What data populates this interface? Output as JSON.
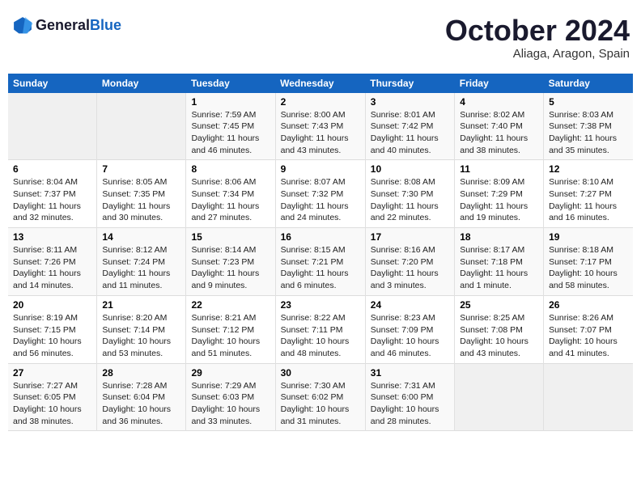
{
  "header": {
    "logo_general": "General",
    "logo_blue": "Blue",
    "month_year": "October 2024",
    "location": "Aliaga, Aragon, Spain"
  },
  "weekdays": [
    "Sunday",
    "Monday",
    "Tuesday",
    "Wednesday",
    "Thursday",
    "Friday",
    "Saturday"
  ],
  "weeks": [
    [
      {
        "day": "",
        "info": ""
      },
      {
        "day": "",
        "info": ""
      },
      {
        "day": "1",
        "info": "Sunrise: 7:59 AM\nSunset: 7:45 PM\nDaylight: 11 hours and 46 minutes."
      },
      {
        "day": "2",
        "info": "Sunrise: 8:00 AM\nSunset: 7:43 PM\nDaylight: 11 hours and 43 minutes."
      },
      {
        "day": "3",
        "info": "Sunrise: 8:01 AM\nSunset: 7:42 PM\nDaylight: 11 hours and 40 minutes."
      },
      {
        "day": "4",
        "info": "Sunrise: 8:02 AM\nSunset: 7:40 PM\nDaylight: 11 hours and 38 minutes."
      },
      {
        "day": "5",
        "info": "Sunrise: 8:03 AM\nSunset: 7:38 PM\nDaylight: 11 hours and 35 minutes."
      }
    ],
    [
      {
        "day": "6",
        "info": "Sunrise: 8:04 AM\nSunset: 7:37 PM\nDaylight: 11 hours and 32 minutes."
      },
      {
        "day": "7",
        "info": "Sunrise: 8:05 AM\nSunset: 7:35 PM\nDaylight: 11 hours and 30 minutes."
      },
      {
        "day": "8",
        "info": "Sunrise: 8:06 AM\nSunset: 7:34 PM\nDaylight: 11 hours and 27 minutes."
      },
      {
        "day": "9",
        "info": "Sunrise: 8:07 AM\nSunset: 7:32 PM\nDaylight: 11 hours and 24 minutes."
      },
      {
        "day": "10",
        "info": "Sunrise: 8:08 AM\nSunset: 7:30 PM\nDaylight: 11 hours and 22 minutes."
      },
      {
        "day": "11",
        "info": "Sunrise: 8:09 AM\nSunset: 7:29 PM\nDaylight: 11 hours and 19 minutes."
      },
      {
        "day": "12",
        "info": "Sunrise: 8:10 AM\nSunset: 7:27 PM\nDaylight: 11 hours and 16 minutes."
      }
    ],
    [
      {
        "day": "13",
        "info": "Sunrise: 8:11 AM\nSunset: 7:26 PM\nDaylight: 11 hours and 14 minutes."
      },
      {
        "day": "14",
        "info": "Sunrise: 8:12 AM\nSunset: 7:24 PM\nDaylight: 11 hours and 11 minutes."
      },
      {
        "day": "15",
        "info": "Sunrise: 8:14 AM\nSunset: 7:23 PM\nDaylight: 11 hours and 9 minutes."
      },
      {
        "day": "16",
        "info": "Sunrise: 8:15 AM\nSunset: 7:21 PM\nDaylight: 11 hours and 6 minutes."
      },
      {
        "day": "17",
        "info": "Sunrise: 8:16 AM\nSunset: 7:20 PM\nDaylight: 11 hours and 3 minutes."
      },
      {
        "day": "18",
        "info": "Sunrise: 8:17 AM\nSunset: 7:18 PM\nDaylight: 11 hours and 1 minute."
      },
      {
        "day": "19",
        "info": "Sunrise: 8:18 AM\nSunset: 7:17 PM\nDaylight: 10 hours and 58 minutes."
      }
    ],
    [
      {
        "day": "20",
        "info": "Sunrise: 8:19 AM\nSunset: 7:15 PM\nDaylight: 10 hours and 56 minutes."
      },
      {
        "day": "21",
        "info": "Sunrise: 8:20 AM\nSunset: 7:14 PM\nDaylight: 10 hours and 53 minutes."
      },
      {
        "day": "22",
        "info": "Sunrise: 8:21 AM\nSunset: 7:12 PM\nDaylight: 10 hours and 51 minutes."
      },
      {
        "day": "23",
        "info": "Sunrise: 8:22 AM\nSunset: 7:11 PM\nDaylight: 10 hours and 48 minutes."
      },
      {
        "day": "24",
        "info": "Sunrise: 8:23 AM\nSunset: 7:09 PM\nDaylight: 10 hours and 46 minutes."
      },
      {
        "day": "25",
        "info": "Sunrise: 8:25 AM\nSunset: 7:08 PM\nDaylight: 10 hours and 43 minutes."
      },
      {
        "day": "26",
        "info": "Sunrise: 8:26 AM\nSunset: 7:07 PM\nDaylight: 10 hours and 41 minutes."
      }
    ],
    [
      {
        "day": "27",
        "info": "Sunrise: 7:27 AM\nSunset: 6:05 PM\nDaylight: 10 hours and 38 minutes."
      },
      {
        "day": "28",
        "info": "Sunrise: 7:28 AM\nSunset: 6:04 PM\nDaylight: 10 hours and 36 minutes."
      },
      {
        "day": "29",
        "info": "Sunrise: 7:29 AM\nSunset: 6:03 PM\nDaylight: 10 hours and 33 minutes."
      },
      {
        "day": "30",
        "info": "Sunrise: 7:30 AM\nSunset: 6:02 PM\nDaylight: 10 hours and 31 minutes."
      },
      {
        "day": "31",
        "info": "Sunrise: 7:31 AM\nSunset: 6:00 PM\nDaylight: 10 hours and 28 minutes."
      },
      {
        "day": "",
        "info": ""
      },
      {
        "day": "",
        "info": ""
      }
    ]
  ]
}
